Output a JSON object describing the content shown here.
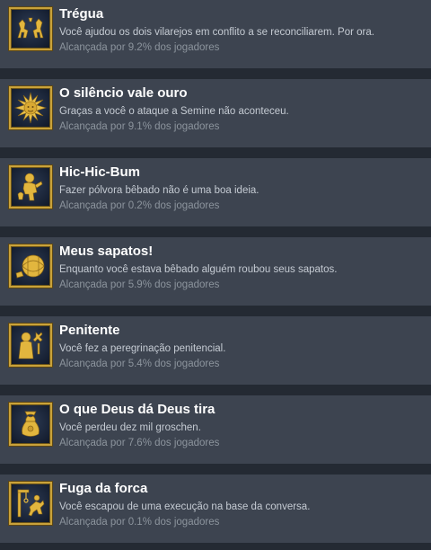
{
  "achievements": [
    {
      "title": "Trégua",
      "description": "Você ajudou os dois vilarejos em conflito a se reconciliarem. Por ora.",
      "unlock_rate": "Alcançada por 9.2% dos jogadores",
      "icon": "two-horses-icon"
    },
    {
      "title": "O silêncio vale ouro",
      "description": "Graças a você o ataque a Semine não aconteceu.",
      "unlock_rate": "Alcançada por 9.1% dos jogadores",
      "icon": "sun-icon"
    },
    {
      "title": "Hic-Hic-Bum",
      "description": "Fazer pólvora bêbado não é uma boa ideia.",
      "unlock_rate": "Alcançada por 0.2% dos jogadores",
      "icon": "drunk-man-icon"
    },
    {
      "title": "Meus sapatos!",
      "description": "Enquanto você estava bêbado alguém roubou seus sapatos.",
      "unlock_rate": "Alcançada por 5.9% dos jogadores",
      "icon": "barrel-icon"
    },
    {
      "title": "Penitente",
      "description": "Você fez a peregrinação penitencial.",
      "unlock_rate": "Alcançada por 5.4% dos jogadores",
      "icon": "pilgrim-icon"
    },
    {
      "title": "O que Deus dá Deus tira",
      "description": "Você perdeu dez mil groschen.",
      "unlock_rate": "Alcançada por 7.6% dos jogadores",
      "icon": "money-pouch-icon"
    },
    {
      "title": "Fuga da forca",
      "description": "Você escapou de uma execução na base da conversa.",
      "unlock_rate": "Alcançada por 0.1% dos jogadores",
      "icon": "gallows-icon"
    }
  ],
  "colors": {
    "background": "#1b2838",
    "row": "#3d4450",
    "icon_border": "#c9a23a",
    "title": "#ffffff",
    "description": "#c5cbd3",
    "unlock_rate": "#8c949d"
  }
}
